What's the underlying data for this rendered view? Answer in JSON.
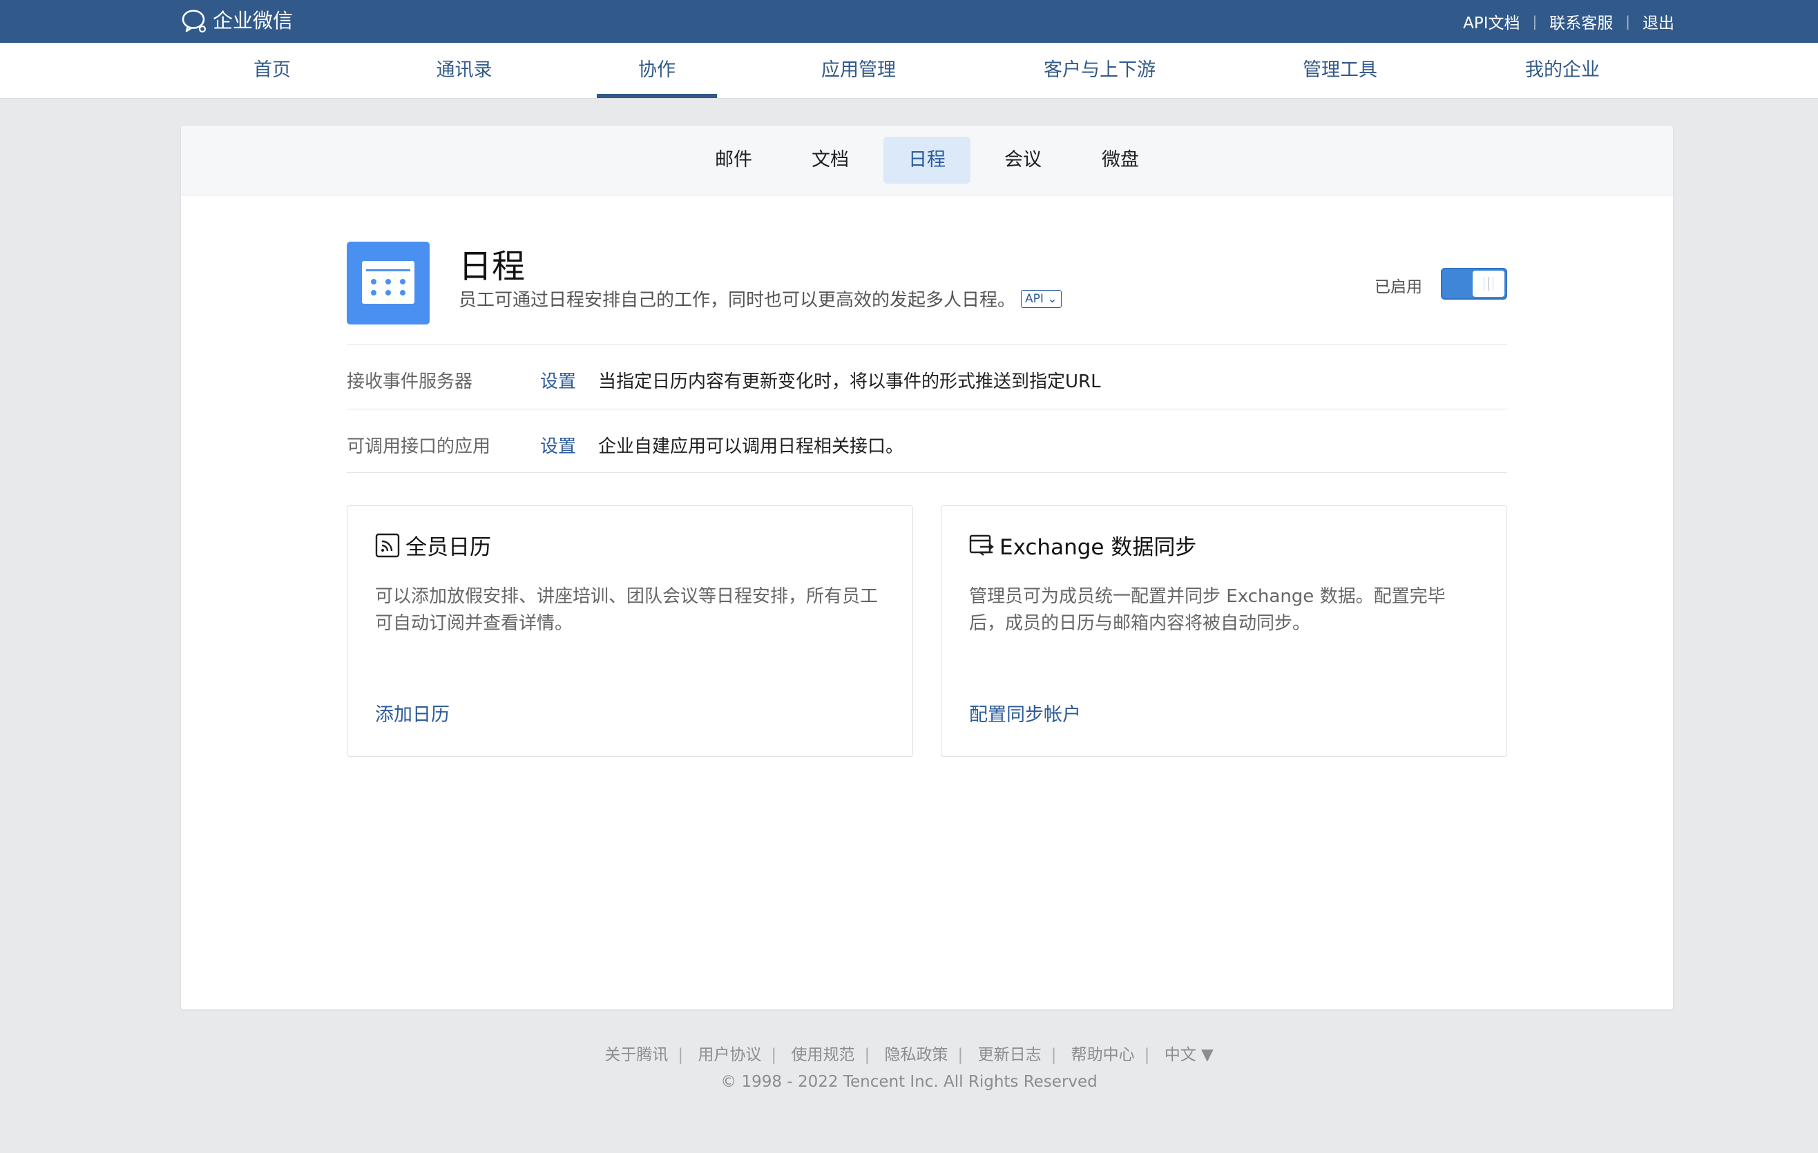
{
  "topbar": {
    "brand": "企业微信",
    "links": [
      "API文档",
      "联系客服",
      "退出"
    ]
  },
  "mainnav": {
    "items": [
      "首页",
      "通讯录",
      "协作",
      "应用管理",
      "客户与上下游",
      "管理工具",
      "我的企业"
    ],
    "active": "协作"
  },
  "subnav": {
    "tabs": [
      "邮件",
      "文档",
      "日程",
      "会议",
      "微盘"
    ],
    "active": "日程"
  },
  "app": {
    "title": "日程",
    "description": "员工可通过日程安排自己的工作，同时也可以更高效的发起多人日程。",
    "api_badge": "API",
    "status_label": "已启用",
    "enabled": true
  },
  "settings": [
    {
      "label": "接收事件服务器",
      "link": "设置",
      "description": "当指定日历内容有更新变化时，将以事件的形式推送到指定URL"
    },
    {
      "label": "可调用接口的应用",
      "link": "设置",
      "description": "企业自建应用可以调用日程相关接口。"
    }
  ],
  "features": [
    {
      "icon": "rss-calendar-icon",
      "title": "全员日历",
      "description": "可以添加放假安排、讲座培训、团队会议等日程安排，所有员工可自动订阅并查看详情。",
      "link": "添加日历"
    },
    {
      "icon": "sync-icon",
      "title": "Exchange 数据同步",
      "description": "管理员可为成员统一配置并同步 Exchange 数据。配置完毕后，成员的日历与邮箱内容将被自动同步。",
      "link": "配置同步帐户"
    }
  ],
  "footer": {
    "links": [
      "关于腾讯",
      "用户协议",
      "使用规范",
      "隐私政策",
      "更新日志",
      "帮助中心"
    ],
    "language": "中文 ▼",
    "copyright": "© 1998 - 2022 Tencent Inc. All Rights Reserved"
  },
  "colors": {
    "topbar": "#31598a",
    "accent": "#2b5a9a",
    "app_icon": "#4a90f0",
    "toggle": "#3f86d8"
  }
}
